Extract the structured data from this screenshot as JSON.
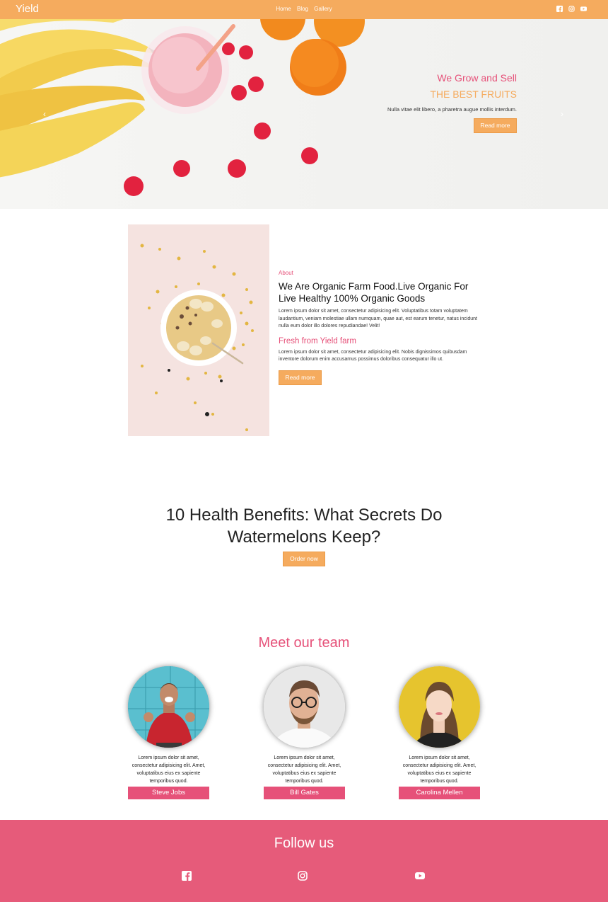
{
  "nav": {
    "brand": "Yield",
    "links": [
      "Home",
      "Blog",
      "Gallery"
    ]
  },
  "hero": {
    "line1": "We Grow and Sell",
    "line2": "THE BEST FRUITS",
    "text": "Nulla vitae elit libero, a pharetra augue mollis interdum.",
    "button": "Read more"
  },
  "about": {
    "tag": "About",
    "title": "We Are Organic Farm Food.Live Organic For Live Healthy 100% Organic Goods",
    "p1": "Lorem ipsum dolor sit amet, consectetur adipisicing elit. Voluptatibus totam voluptatem laudantium, veniam molestiae ullam numquam, quae aut, est earum tenetur, natus incidunt nulla eum dolor illo dolores repudiandae! Velit!",
    "subtitle": "Fresh from Yield farm",
    "p2": "Lorem ipsum dolor sit amet, consectetur adipisicing elit. Nobis dignissimos quibusdam inventore dolorum enim accusamus possimus doloribus consequatur illo ut.",
    "button": "Read more"
  },
  "promo": {
    "title": "10 Health Benefits: What Secrets Do Watermelons Keep?",
    "button": "Order now"
  },
  "team": {
    "title": "Meet our team",
    "members": [
      {
        "name": "Steve Jobs",
        "text": "Lorem ipsum dolor sit amet, consectetur adipisicing elit. Amet, voluptatibus eius ex sapiente temporibus quod."
      },
      {
        "name": "Bill Gates",
        "text": "Lorem ipsum dolor sit amet, consectetur adipisicing elit. Amet, voluptatibus eius ex sapiente temporibus quod."
      },
      {
        "name": "Carolina Mellen",
        "text": "Lorem ipsum dolor sit amet, consectetur adipisicing elit. Amet, voluptatibus eius ex sapiente temporibus quod."
      }
    ]
  },
  "footer": {
    "title": "Follow us",
    "icons": [
      "facebook-icon",
      "instagram-icon",
      "youtube-icon"
    ]
  },
  "colors": {
    "accent": "#f5ab5e",
    "pink": "#e65179",
    "footer": "#e65b7a"
  }
}
